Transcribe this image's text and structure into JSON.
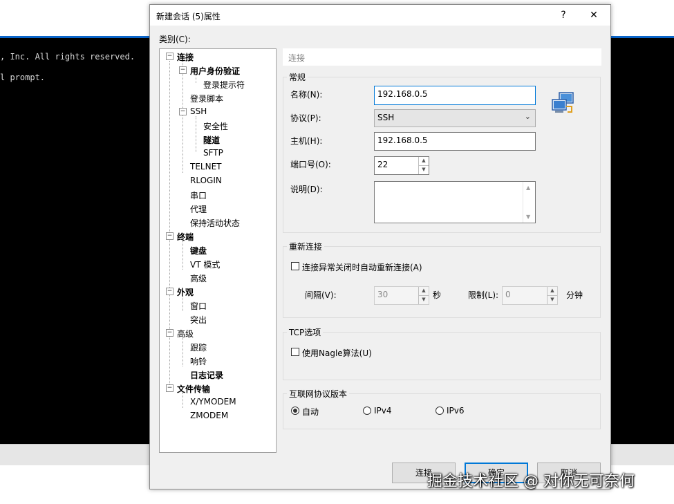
{
  "background": {
    "terminal_lines": [
      ", Inc. All rights reserved.",
      "l prompt."
    ]
  },
  "dialog": {
    "title": "新建会话 (5)属性",
    "help_btn": "?",
    "close_btn": "✕",
    "category_label": "类别(C):",
    "tree": {
      "connection": "连接",
      "auth": "用户身份验证",
      "login_prompt": "登录提示符",
      "login_script": "登录脚本",
      "ssh": "SSH",
      "security": "安全性",
      "tunnel": "隧道",
      "sftp": "SFTP",
      "telnet": "TELNET",
      "rlogin": "RLOGIN",
      "serial": "串口",
      "proxy": "代理",
      "keepalive": "保持活动状态",
      "terminal": "终端",
      "keyboard": "键盘",
      "vt_mode": "VT 模式",
      "terminal_advanced": "高级",
      "appearance": "外观",
      "window": "窗口",
      "highlight": "突出",
      "advanced": "高级",
      "trace": "跟踪",
      "bell": "响铃",
      "logging": "日志记录",
      "file_transfer": "文件传输",
      "xymodem": "X/YMODEM",
      "zmodem": "ZMODEM"
    },
    "section_header": "连接",
    "general": {
      "title": "常规",
      "name_label": "名称(N):",
      "name_value": "192.168.0.5",
      "protocol_label": "协议(P):",
      "protocol_value": "SSH",
      "host_label": "主机(H):",
      "host_value": "192.168.0.5",
      "port_label": "端口号(O):",
      "port_value": "22",
      "desc_label": "说明(D):",
      "desc_value": ""
    },
    "reconnect": {
      "title": "重新连接",
      "auto_label": "连接异常关闭时自动重新连接(A)",
      "auto_checked": false,
      "interval_label": "间隔(V):",
      "interval_value": "30",
      "interval_unit": "秒",
      "limit_label": "限制(L):",
      "limit_value": "0",
      "limit_unit": "分钟"
    },
    "tcp": {
      "title": "TCP选项",
      "nagle_label": "使用Nagle算法(U)",
      "nagle_checked": false
    },
    "ip_version": {
      "title": "互联网协议版本",
      "options": [
        "自动",
        "IPv4",
        "IPv6"
      ],
      "selected": "自动"
    },
    "buttons": {
      "connect": "连接",
      "ok": "确定",
      "cancel": "取消"
    }
  },
  "watermark": "掘金技术社区 @ 对你无可奈何",
  "colors": {
    "accent": "#0078d7",
    "terminal_bg": "#000000",
    "topbar_accent": "#0a64c8"
  }
}
